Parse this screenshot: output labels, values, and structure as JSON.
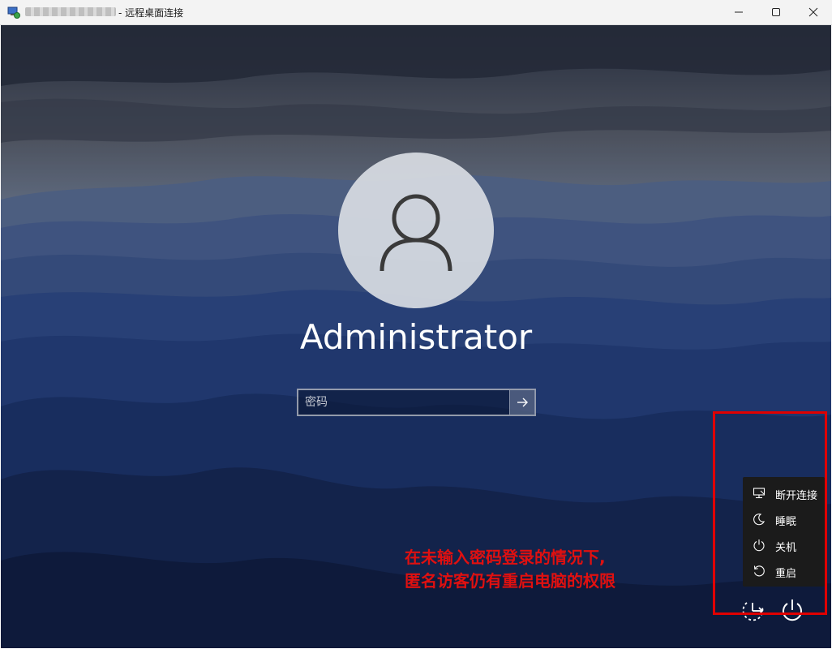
{
  "window": {
    "title": "- 远程桌面连接"
  },
  "lock_screen": {
    "username": "Administrator",
    "password_placeholder": "密码"
  },
  "power_menu": {
    "items": [
      {
        "label": "断开连接",
        "icon": "disconnect-icon"
      },
      {
        "label": "睡眠",
        "icon": "moon-icon"
      },
      {
        "label": "关机",
        "icon": "power-icon"
      },
      {
        "label": "重启",
        "icon": "restart-icon"
      }
    ]
  },
  "annotation": {
    "line1": "在未输入密码登录的情况下,",
    "line2": "匿名访客仍有重启电脑的权限"
  },
  "colors": {
    "highlight": "#e00000",
    "annotation_text": "#e01010",
    "menu_background": "#1b1b1b"
  }
}
